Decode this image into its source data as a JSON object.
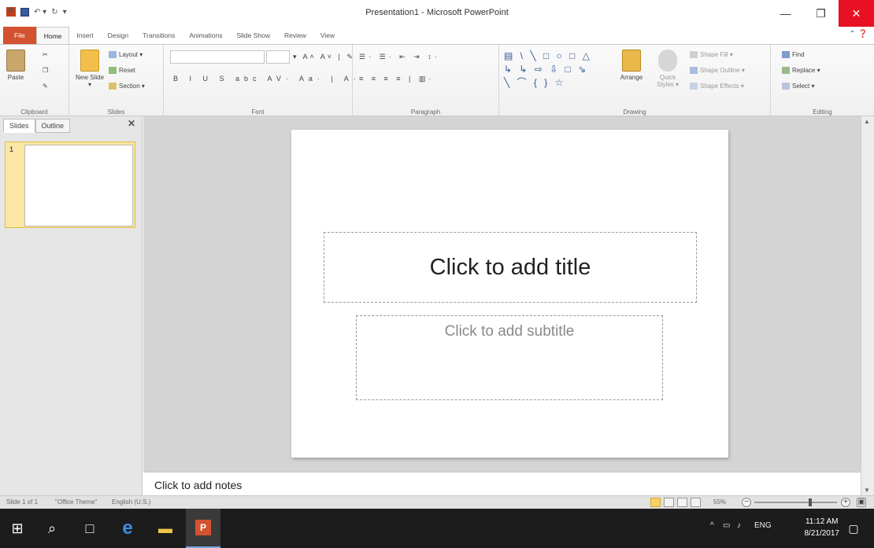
{
  "window": {
    "title": "Presentation1 - Microsoft PowerPoint",
    "minimize_glyph": "—",
    "maximize_glyph": "❐",
    "close_glyph": "✕"
  },
  "qat": {
    "undo": "↶ ▾",
    "redo": "↻",
    "customize": "▾",
    "app_icon_letter": "P"
  },
  "ribbon_tabs": [
    "File",
    "Home",
    "Insert",
    "Design",
    "Transitions",
    "Animations",
    "Slide Show",
    "Review",
    "View"
  ],
  "ribbon": {
    "clipboard": {
      "paste": "Paste",
      "label": "Clipboard"
    },
    "slides": {
      "new_slide": "New Slide ▾",
      "layout": "Layout ▾",
      "reset": "Reset",
      "section": "Section ▾",
      "label": "Slides"
    },
    "font": {
      "format_row": "B I U S abc AV· Aa· | A·",
      "grow_shrink": "▾ A˄ A˅ | ✎",
      "label": "Font"
    },
    "paragraph": {
      "row1": "☰· ☰· ⇤ ⇥ ↕·",
      "row2": "≡ ≡ ≡ ≡ | ▥·",
      "label": "Paragraph"
    },
    "drawing": {
      "shapes": "▤ \\ ╲ □ ○ □ △ ↳ ↳ ⇨ ⇩ □ ⇘ ╲ ⌒ { } ☆",
      "arrange": "Arrange",
      "quick_styles": "Quick Styles ▾",
      "shape_fill": "Shape Fill ▾",
      "shape_outline": "Shape Outline ▾",
      "shape_effects": "Shape Effects ▾",
      "label": "Drawing"
    },
    "editing": {
      "find": "Find",
      "replace": "Replace ▾",
      "select": "Select ▾",
      "label": "Editing"
    }
  },
  "left_pane": {
    "tabs": [
      "Slides",
      "Outline"
    ],
    "close_glyph": "✕",
    "slide_number": "1"
  },
  "slide": {
    "title_placeholder": "Click to add title",
    "subtitle_placeholder": "Click to add subtitle"
  },
  "notes": {
    "placeholder": "Click to add notes"
  },
  "status": {
    "slide_info": "Slide 1 of 1",
    "theme": "\"Office Theme\"",
    "language": "English (U.S.)",
    "zoom": "55%"
  },
  "taskbar": {
    "clock_time": "11:12 AM",
    "clock_date": "8/21/2017",
    "lang": "ENG",
    "tray_chevron": "^",
    "start_glyph": "⊞",
    "search_glyph": "⌕",
    "taskview_glyph": "□",
    "edge_glyph": "e",
    "explorer_glyph": "▬",
    "ppt_glyph": "P",
    "network_glyph": "▭",
    "volume_glyph": "♪",
    "notify_glyph": "▢"
  }
}
